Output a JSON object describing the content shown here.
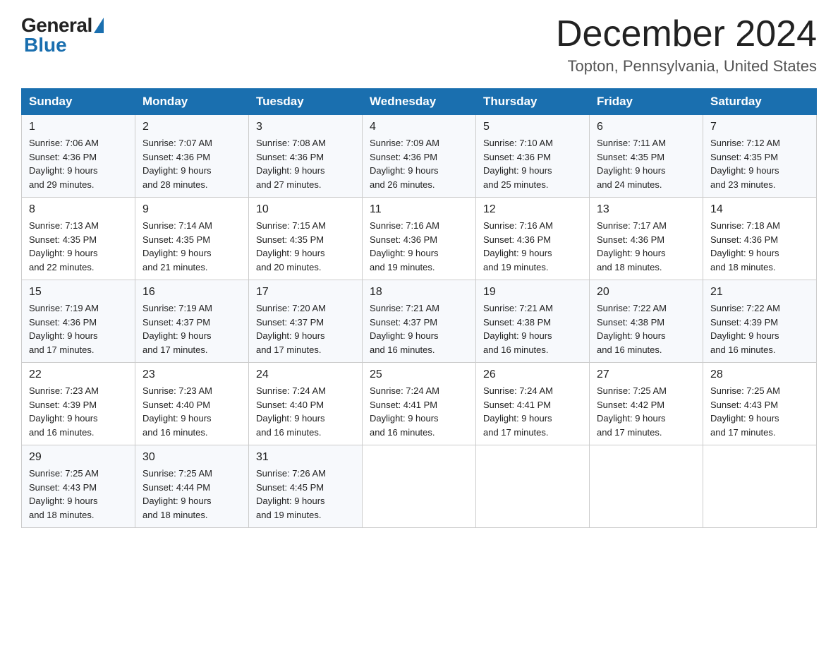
{
  "header": {
    "logo_general": "General",
    "logo_blue": "Blue",
    "month_title": "December 2024",
    "subtitle": "Topton, Pennsylvania, United States"
  },
  "days_of_week": [
    "Sunday",
    "Monday",
    "Tuesday",
    "Wednesday",
    "Thursday",
    "Friday",
    "Saturday"
  ],
  "weeks": [
    [
      {
        "day": "1",
        "sunrise": "7:06 AM",
        "sunset": "4:36 PM",
        "daylight": "9 hours and 29 minutes."
      },
      {
        "day": "2",
        "sunrise": "7:07 AM",
        "sunset": "4:36 PM",
        "daylight": "9 hours and 28 minutes."
      },
      {
        "day": "3",
        "sunrise": "7:08 AM",
        "sunset": "4:36 PM",
        "daylight": "9 hours and 27 minutes."
      },
      {
        "day": "4",
        "sunrise": "7:09 AM",
        "sunset": "4:36 PM",
        "daylight": "9 hours and 26 minutes."
      },
      {
        "day": "5",
        "sunrise": "7:10 AM",
        "sunset": "4:36 PM",
        "daylight": "9 hours and 25 minutes."
      },
      {
        "day": "6",
        "sunrise": "7:11 AM",
        "sunset": "4:35 PM",
        "daylight": "9 hours and 24 minutes."
      },
      {
        "day": "7",
        "sunrise": "7:12 AM",
        "sunset": "4:35 PM",
        "daylight": "9 hours and 23 minutes."
      }
    ],
    [
      {
        "day": "8",
        "sunrise": "7:13 AM",
        "sunset": "4:35 PM",
        "daylight": "9 hours and 22 minutes."
      },
      {
        "day": "9",
        "sunrise": "7:14 AM",
        "sunset": "4:35 PM",
        "daylight": "9 hours and 21 minutes."
      },
      {
        "day": "10",
        "sunrise": "7:15 AM",
        "sunset": "4:35 PM",
        "daylight": "9 hours and 20 minutes."
      },
      {
        "day": "11",
        "sunrise": "7:16 AM",
        "sunset": "4:36 PM",
        "daylight": "9 hours and 19 minutes."
      },
      {
        "day": "12",
        "sunrise": "7:16 AM",
        "sunset": "4:36 PM",
        "daylight": "9 hours and 19 minutes."
      },
      {
        "day": "13",
        "sunrise": "7:17 AM",
        "sunset": "4:36 PM",
        "daylight": "9 hours and 18 minutes."
      },
      {
        "day": "14",
        "sunrise": "7:18 AM",
        "sunset": "4:36 PM",
        "daylight": "9 hours and 18 minutes."
      }
    ],
    [
      {
        "day": "15",
        "sunrise": "7:19 AM",
        "sunset": "4:36 PM",
        "daylight": "9 hours and 17 minutes."
      },
      {
        "day": "16",
        "sunrise": "7:19 AM",
        "sunset": "4:37 PM",
        "daylight": "9 hours and 17 minutes."
      },
      {
        "day": "17",
        "sunrise": "7:20 AM",
        "sunset": "4:37 PM",
        "daylight": "9 hours and 17 minutes."
      },
      {
        "day": "18",
        "sunrise": "7:21 AM",
        "sunset": "4:37 PM",
        "daylight": "9 hours and 16 minutes."
      },
      {
        "day": "19",
        "sunrise": "7:21 AM",
        "sunset": "4:38 PM",
        "daylight": "9 hours and 16 minutes."
      },
      {
        "day": "20",
        "sunrise": "7:22 AM",
        "sunset": "4:38 PM",
        "daylight": "9 hours and 16 minutes."
      },
      {
        "day": "21",
        "sunrise": "7:22 AM",
        "sunset": "4:39 PM",
        "daylight": "9 hours and 16 minutes."
      }
    ],
    [
      {
        "day": "22",
        "sunrise": "7:23 AM",
        "sunset": "4:39 PM",
        "daylight": "9 hours and 16 minutes."
      },
      {
        "day": "23",
        "sunrise": "7:23 AM",
        "sunset": "4:40 PM",
        "daylight": "9 hours and 16 minutes."
      },
      {
        "day": "24",
        "sunrise": "7:24 AM",
        "sunset": "4:40 PM",
        "daylight": "9 hours and 16 minutes."
      },
      {
        "day": "25",
        "sunrise": "7:24 AM",
        "sunset": "4:41 PM",
        "daylight": "9 hours and 16 minutes."
      },
      {
        "day": "26",
        "sunrise": "7:24 AM",
        "sunset": "4:41 PM",
        "daylight": "9 hours and 17 minutes."
      },
      {
        "day": "27",
        "sunrise": "7:25 AM",
        "sunset": "4:42 PM",
        "daylight": "9 hours and 17 minutes."
      },
      {
        "day": "28",
        "sunrise": "7:25 AM",
        "sunset": "4:43 PM",
        "daylight": "9 hours and 17 minutes."
      }
    ],
    [
      {
        "day": "29",
        "sunrise": "7:25 AM",
        "sunset": "4:43 PM",
        "daylight": "9 hours and 18 minutes."
      },
      {
        "day": "30",
        "sunrise": "7:25 AM",
        "sunset": "4:44 PM",
        "daylight": "9 hours and 18 minutes."
      },
      {
        "day": "31",
        "sunrise": "7:26 AM",
        "sunset": "4:45 PM",
        "daylight": "9 hours and 19 minutes."
      },
      null,
      null,
      null,
      null
    ]
  ],
  "labels": {
    "sunrise": "Sunrise:",
    "sunset": "Sunset:",
    "daylight": "Daylight:"
  }
}
